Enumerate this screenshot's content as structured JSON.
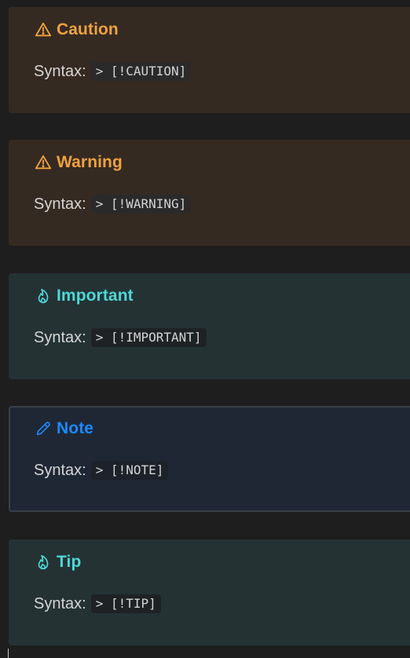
{
  "colors": {
    "caution": "#f0a240",
    "warning": "#f0a240",
    "important": "#4fd6d6",
    "note": "#1e88ff",
    "tip": "#4fd6d6"
  },
  "callouts": [
    {
      "title": "Caution",
      "icon": "warning-triangle-icon",
      "syntax_label": "Syntax:",
      "syntax_code": "> [!CAUTION]"
    },
    {
      "title": "Warning",
      "icon": "warning-triangle-icon",
      "syntax_label": "Syntax:",
      "syntax_code": "> [!WARNING]"
    },
    {
      "title": "Important",
      "icon": "flame-icon",
      "syntax_label": "Syntax:",
      "syntax_code": "> [!IMPORTANT]"
    },
    {
      "title": "Note",
      "icon": "pencil-icon",
      "syntax_label": "Syntax:",
      "syntax_code": "> [!NOTE]"
    },
    {
      "title": "Tip",
      "icon": "flame-icon",
      "syntax_label": "Syntax:",
      "syntax_code": "> [!TIP]"
    }
  ]
}
